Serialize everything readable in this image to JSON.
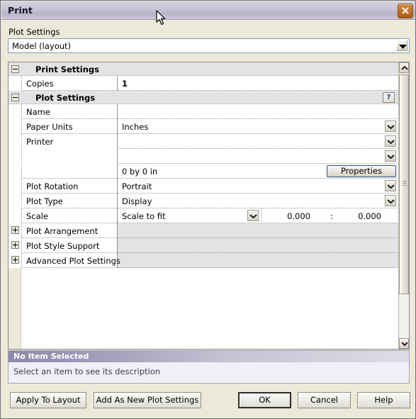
{
  "window": {
    "title": "Print",
    "close_icon": "close-icon"
  },
  "top": {
    "label": "Plot Settings",
    "combo_value": "Model (layout)",
    "combo_arrow_icon": "chevron-down-icon"
  },
  "grid": {
    "rows": [
      {
        "kind": "category",
        "label": "Print Settings",
        "expander": "minus"
      },
      {
        "kind": "property",
        "label": "Copies",
        "value": "1",
        "bold": true
      },
      {
        "kind": "category",
        "label": "Plot Settings",
        "expander": "minus",
        "help": "?"
      },
      {
        "kind": "property",
        "label": "Name",
        "value": ""
      },
      {
        "kind": "property",
        "label": "Paper Units",
        "value": "Inches",
        "dropdown": true
      },
      {
        "kind": "property-tall",
        "label": "Printer",
        "sub": [
          {
            "value": "",
            "dropdown": true
          },
          {
            "value": "",
            "dropdown": true
          },
          {
            "value": "0 by 0 in",
            "button": "Properties"
          }
        ]
      },
      {
        "kind": "property",
        "label": "Plot Rotation",
        "value": "Portrait",
        "dropdown": true
      },
      {
        "kind": "property",
        "label": "Plot Type",
        "value": "Display",
        "dropdown": true
      },
      {
        "kind": "property",
        "label": "Scale",
        "value": "Scale to fit",
        "dropdown_inline": true,
        "num1": "0.000",
        "colon": ":",
        "num2": "0.000"
      },
      {
        "kind": "collapsed",
        "label": "Plot Arrangement",
        "expander": "plus"
      },
      {
        "kind": "collapsed",
        "label": "Plot Style Support",
        "expander": "plus"
      },
      {
        "kind": "collapsed",
        "label": "Advanced Plot Settings",
        "expander": "plus"
      }
    ],
    "scrollbar": {
      "up_icon": "chevron-up-icon",
      "down_icon": "chevron-down-icon",
      "grip_icon": "grip-icon"
    }
  },
  "description": {
    "title": "No Item Selected",
    "body": "Select an item to see its description"
  },
  "buttons": {
    "apply": "Apply To Layout",
    "add_new": "Add As New Plot Settings",
    "ok": "OK",
    "cancel": "Cancel",
    "help": "Help"
  }
}
